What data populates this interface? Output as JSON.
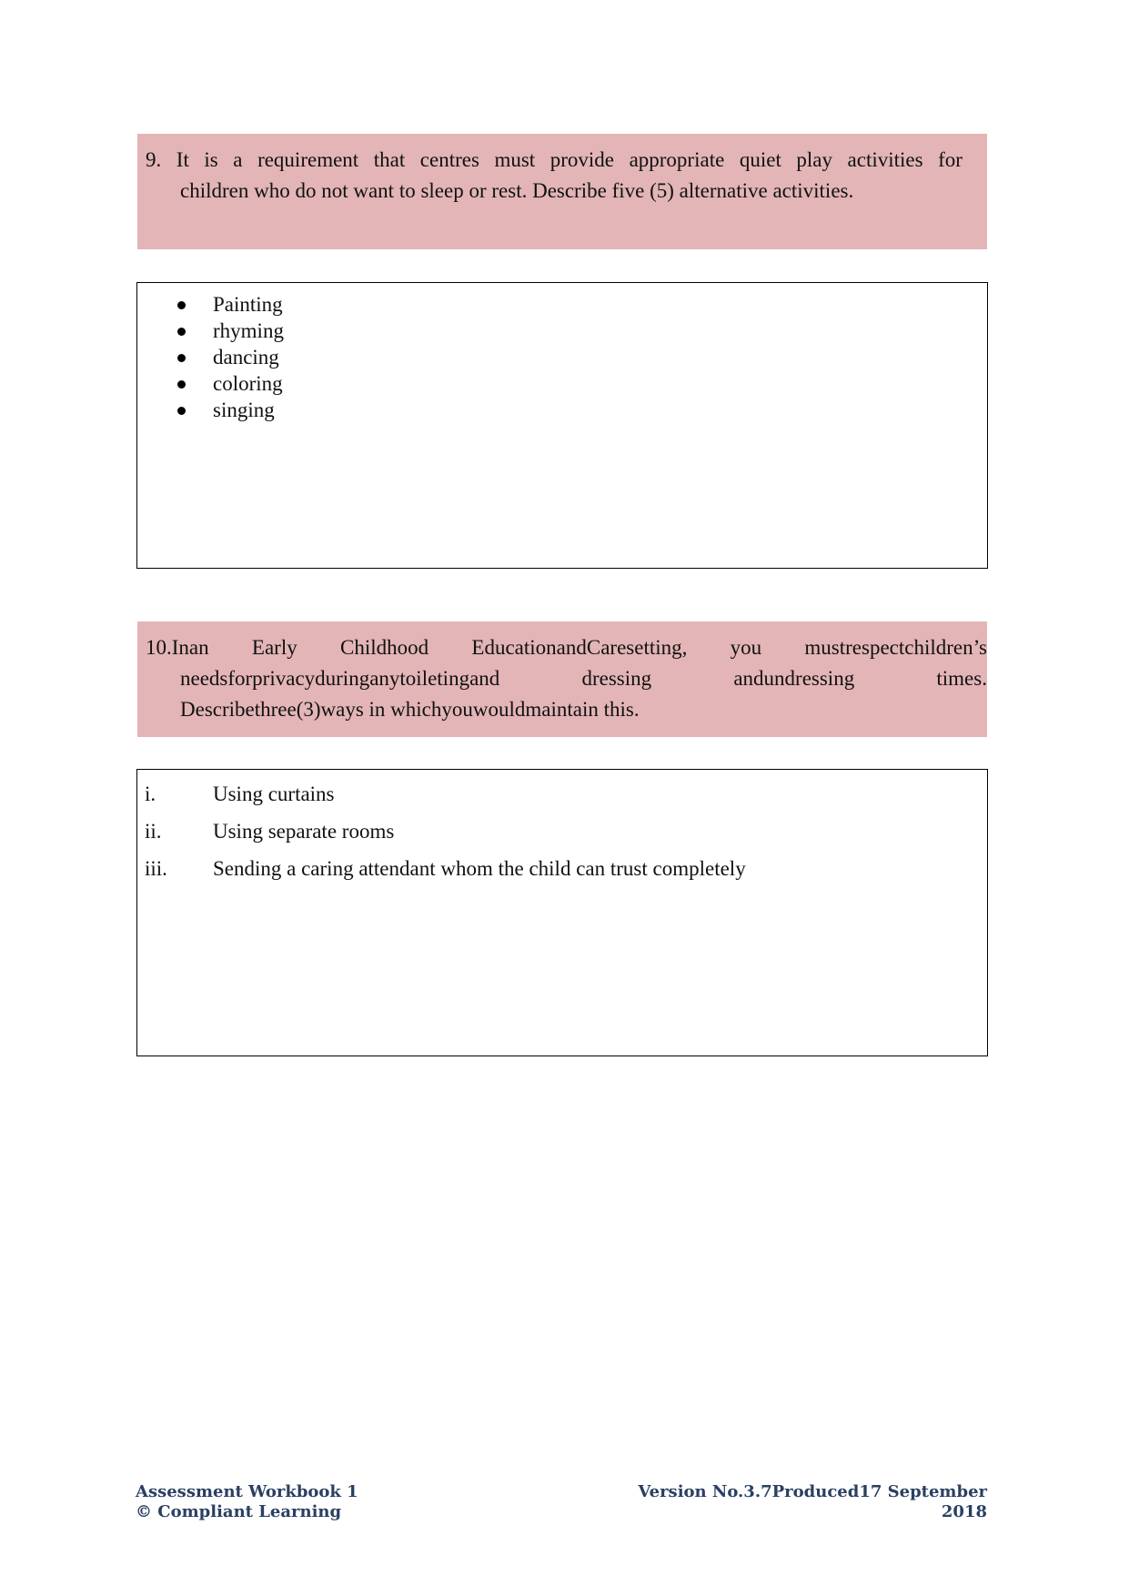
{
  "questions": [
    {
      "number": "9.",
      "lines": [
        [
          "It",
          "is",
          "a",
          "requirement",
          "that",
          "centres",
          "must",
          "provide",
          "appropriate",
          "quiet",
          "play",
          "activities",
          "for"
        ],
        "children who do not want to sleep or rest. Describe five (5) alternative activities."
      ],
      "answer_type": "bullets",
      "answers": [
        "Painting",
        "rhyming",
        "dancing",
        "coloring",
        "singing"
      ]
    },
    {
      "number": "10.",
      "lines": [
        [
          "Inan",
          "Early",
          "Childhood",
          "EducationandCaresetting,",
          "you",
          "mustrespectchildren’s"
        ],
        [
          "needsforprivacyduringanytoiletingand",
          "dressing",
          "andundressing",
          "times."
        ],
        "Describethree(3)ways in whichyouwouldmaintain this."
      ],
      "answer_type": "roman",
      "answers": [
        {
          "marker": "i.",
          "text": "Using curtains"
        },
        {
          "marker": "ii.",
          "text": "Using separate rooms"
        },
        {
          "marker": "iii.",
          "text": "Sending a caring attendant whom the child can trust completely"
        }
      ]
    }
  ],
  "footer": {
    "left_line1": "Assessment Workbook 1",
    "left_line2": "© Compliant Learning",
    "right_line1": "Version No.3.7Produced17 September",
    "right_line2": "2018"
  },
  "colors": {
    "question_background": "#e3b5b6",
    "footer_text": "#2a3f62"
  }
}
